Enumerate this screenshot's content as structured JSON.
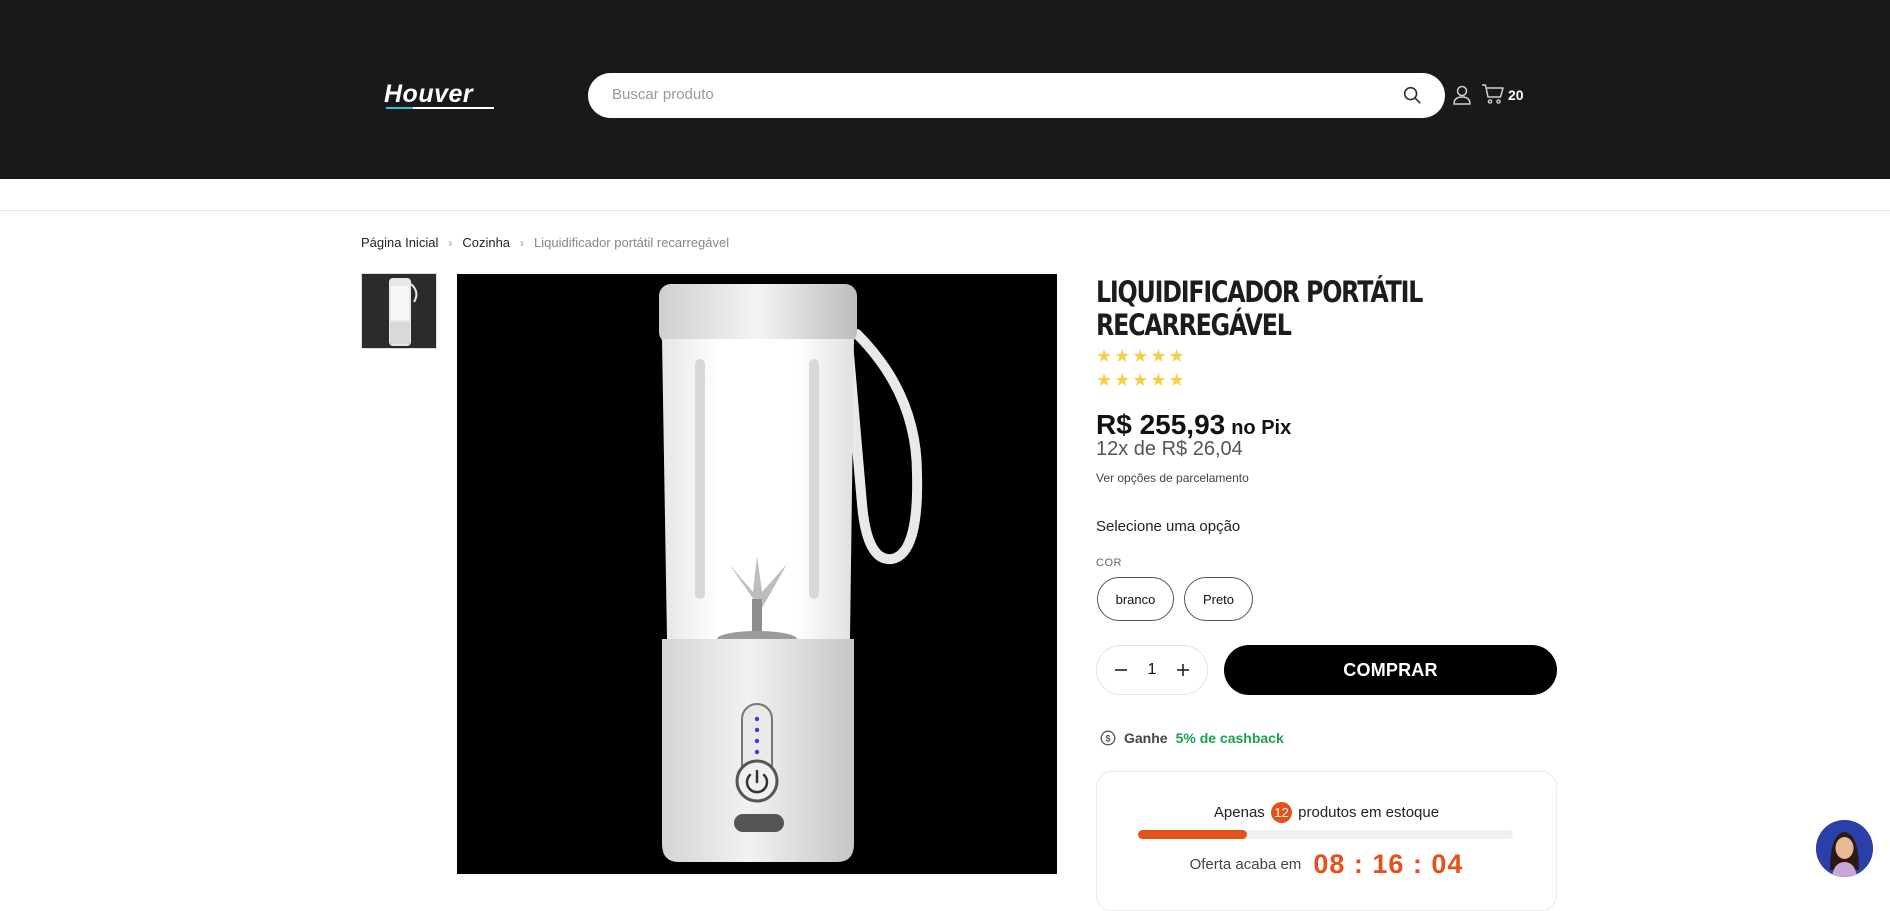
{
  "header": {
    "logo_text": "Houver",
    "search_placeholder": "Buscar produto",
    "cart_count": "20"
  },
  "breadcrumb": {
    "items": [
      "Página Inicial",
      "Cozinha",
      "Liquidificador portátil recarregável"
    ]
  },
  "product": {
    "title": "LIQUIDIFICADOR PORTÁTIL RECARREGÁVEL",
    "rating_rows": 2,
    "stars_per_row": 5,
    "price": "R$ 255,93",
    "price_suffix": "no Pix",
    "installments": "12x de R$ 26,04",
    "installments_link": "Ver opções de parcelamento",
    "select_label": "Selecione uma opção",
    "color_label": "COR",
    "color_options": [
      "branco",
      "Preto"
    ],
    "quantity": "1",
    "buy_label": "COMPRAR"
  },
  "cashback": {
    "prefix": "Ganhe",
    "highlight": "5% de cashback"
  },
  "stock": {
    "prefix": "Apenas",
    "count": "12",
    "suffix": "produtos em estoque",
    "progress_fraction": 0.29,
    "timer_label": "Oferta acaba em",
    "timer": "08 : 16 : 04"
  },
  "colors": {
    "header_bg": "#19181a",
    "accent_orange": "#e4511b",
    "cashback_green": "#1fa04a",
    "star_yellow": "#f5d04a"
  },
  "icons": [
    "search-icon",
    "user-icon",
    "cart-icon",
    "chevron-right-icon",
    "minus-icon",
    "plus-icon",
    "cashback-coin-icon",
    "chat-avatar"
  ]
}
